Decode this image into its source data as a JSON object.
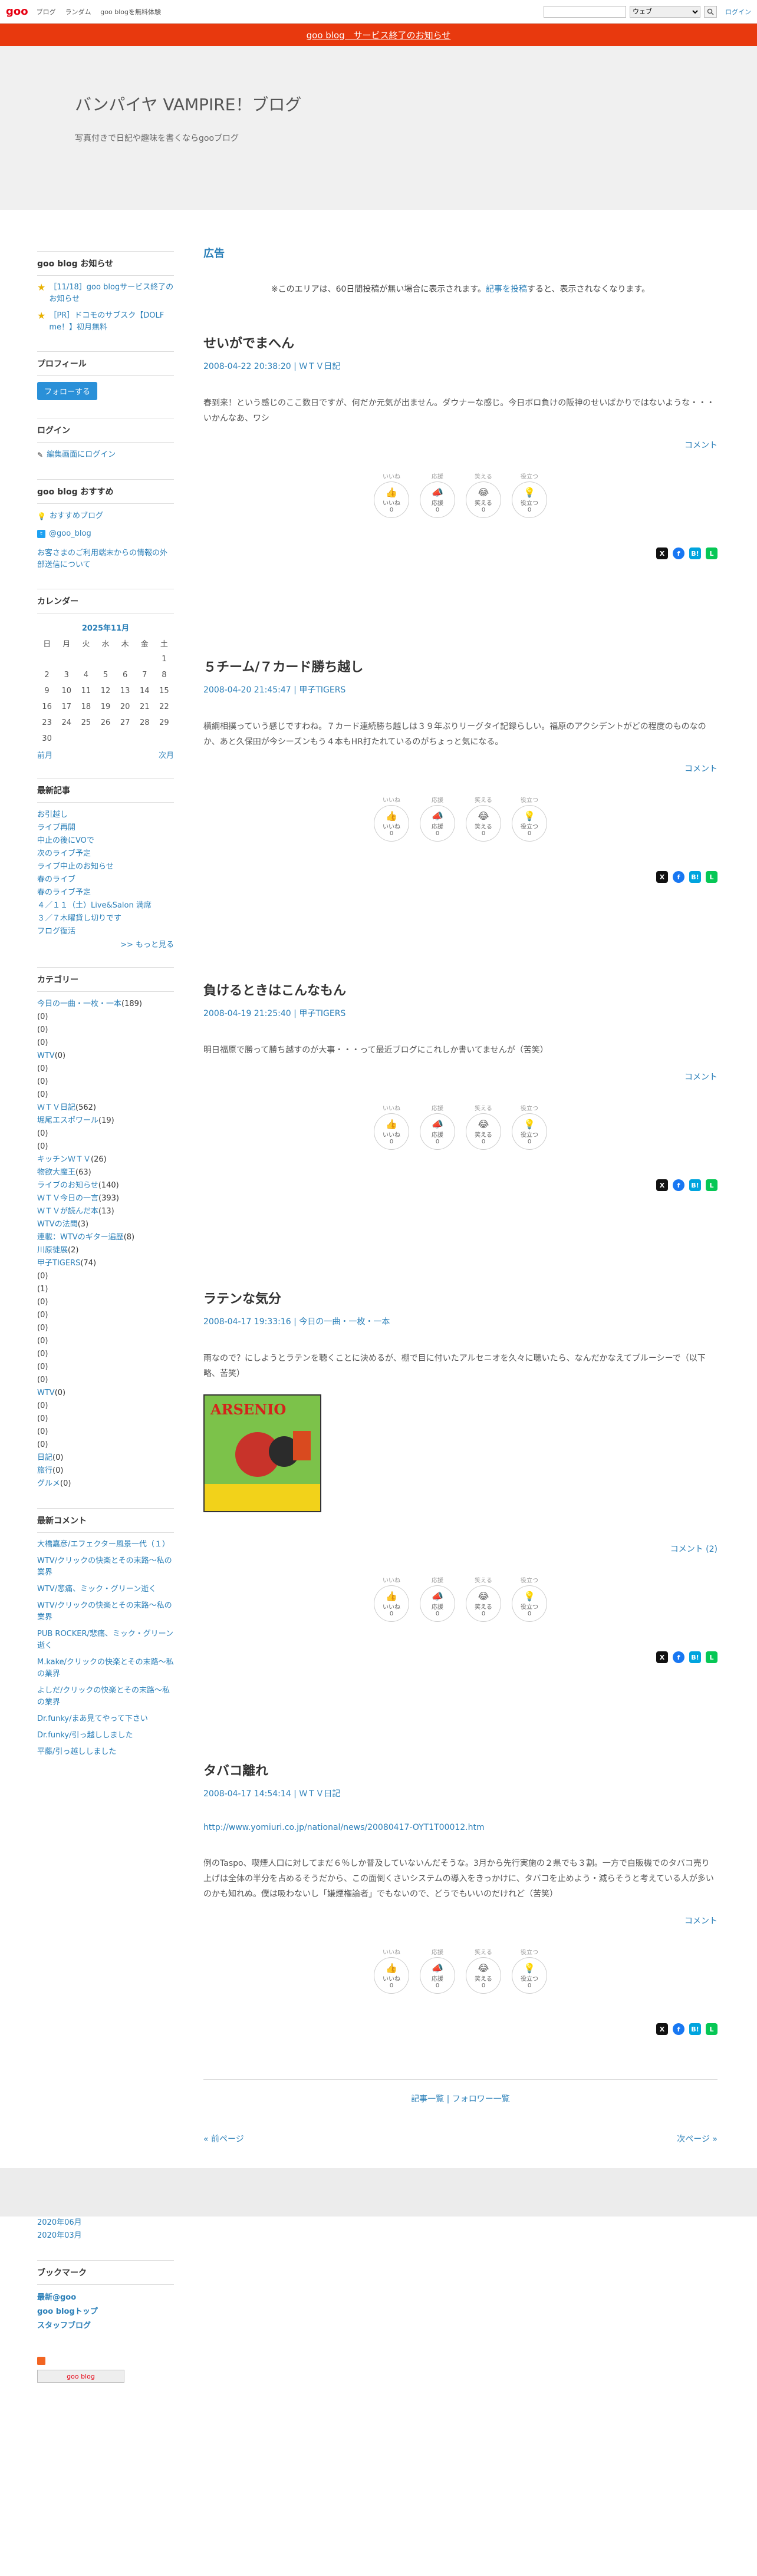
{
  "topbar": {
    "logo": "goo",
    "nav": [
      "ブログ",
      "ランダム",
      "goo blogを無料体験"
    ],
    "search_select": "ウェブ",
    "login": "ログイン"
  },
  "notice": "goo blog　サービス終了のお知らせ",
  "header": {
    "title": "バンパイヤ VAMPIRE！ブログ",
    "description": "写真付きで日記や趣味を書くならgooブログ"
  },
  "sidebar": {
    "info_heading": "goo blog お知らせ",
    "info_items": [
      "［11/18］goo blogサービス終了のお知らせ",
      "［PR］ドコモのサブスク【DOLF me！】初月無料"
    ],
    "profile_heading": "プロフィール",
    "follow_label": "フォローする",
    "login_heading": "ログイン",
    "login_link": "編集画面にログイン",
    "recommend_heading": "goo blog おすすめ",
    "recommend_links": [
      "おすすめブログ",
      "@goo_blog",
      "お客さまのご利用端末からの情報の外部送信について"
    ],
    "calendar_heading": "カレンダー",
    "calendar": {
      "caption": "2025年11月",
      "weekdays": [
        "日",
        "月",
        "火",
        "水",
        "木",
        "金",
        "土"
      ],
      "weeks": [
        [
          "",
          "",
          "",
          "",
          "",
          "",
          "1"
        ],
        [
          "2",
          "3",
          "4",
          "5",
          "6",
          "7",
          "8"
        ],
        [
          "9",
          "10",
          "11",
          "12",
          "13",
          "14",
          "15"
        ],
        [
          "16",
          "17",
          "18",
          "19",
          "20",
          "21",
          "22"
        ],
        [
          "23",
          "24",
          "25",
          "26",
          "27",
          "28",
          "29"
        ],
        [
          "30",
          "",
          "",
          "",
          "",
          "",
          ""
        ]
      ],
      "prev": "前月",
      "next": "次月"
    },
    "recent_heading": "最新記事",
    "recent_links": [
      "お引越し",
      "ライブ再開",
      "中止の後にVOで",
      "次のライブ予定",
      "ライブ中止のお知らせ",
      "春のライブ",
      "春のライブ予定",
      "４／１１（土）Live&Salon 満席",
      "３／７木曜貸し切りです",
      "フログ復活"
    ],
    "recent_more": ">> もっと見る",
    "category_heading": "カテゴリー",
    "categories": [
      {
        "name": "今日の一曲・一枚・一本",
        "count": "(189)"
      },
      {
        "name": "",
        "count": "(0)"
      },
      {
        "name": "",
        "count": "(0)"
      },
      {
        "name": "",
        "count": "(0)"
      },
      {
        "name": "WTV",
        "count": "(0)"
      },
      {
        "name": "",
        "count": "(0)"
      },
      {
        "name": "",
        "count": "(0)"
      },
      {
        "name": "",
        "count": "(0)"
      },
      {
        "name": "ＷＴＶ日記",
        "count": "(562)"
      },
      {
        "name": "堀尾エスポワール",
        "count": "(19)"
      },
      {
        "name": "",
        "count": "(0)"
      },
      {
        "name": "",
        "count": "(0)"
      },
      {
        "name": "キッチンＷＴＶ",
        "count": "(26)"
      },
      {
        "name": "物欲大魔王",
        "count": "(63)"
      },
      {
        "name": "ライブのお知らせ",
        "count": "(140)"
      },
      {
        "name": "ＷＴＶ今日の一言",
        "count": "(393)"
      },
      {
        "name": "ＷＴＶが読んだ本",
        "count": "(13)"
      },
      {
        "name": "WTVの法問",
        "count": "(3)"
      },
      {
        "name": "連載：WTVのギター遍歴",
        "count": "(8)"
      },
      {
        "name": "川原徒展",
        "count": "(2)"
      },
      {
        "name": "甲子TIGERS",
        "count": "(74)"
      },
      {
        "name": "",
        "count": "(0)"
      },
      {
        "name": "",
        "count": "(1)"
      },
      {
        "name": "",
        "count": "(0)"
      },
      {
        "name": "",
        "count": "(0)"
      },
      {
        "name": "",
        "count": "(0)"
      },
      {
        "name": "",
        "count": "(0)"
      },
      {
        "name": "",
        "count": "(0)"
      },
      {
        "name": "",
        "count": "(0)"
      },
      {
        "name": "",
        "count": "(0)"
      },
      {
        "name": "WTV",
        "count": "(0)"
      },
      {
        "name": "",
        "count": "(0)"
      },
      {
        "name": "",
        "count": "(0)"
      },
      {
        "name": "",
        "count": "(0)"
      },
      {
        "name": "",
        "count": "(0)"
      },
      {
        "name": "日記",
        "count": "(0)"
      },
      {
        "name": "旅行",
        "count": "(0)"
      },
      {
        "name": "グルメ",
        "count": "(0)"
      }
    ],
    "comments_heading": "最新コメント",
    "comments": [
      "大橋嘉彦/エフェクター風景一代（１）",
      "WTV/クリックの快楽とその末路～私の業界",
      "WTV/悲痛、ミック・グリーン逝く",
      "WTV/クリックの快楽とその末路～私の業界",
      "PUB ROCKER/悲痛、ミック・グリーン逝く",
      "M.kake/クリックの快楽とその末路～私の業界",
      "よしだ/クリックの快楽とその末路～私の業界",
      "Dr.funky/まあ見てやって下さい",
      "Dr.funky/引っ越ししました",
      "平藤/引っ越ししました"
    ]
  },
  "main": {
    "ad_title": "広告",
    "ad_note_before": "※このエリアは、60日間投稿が無い場合に表示されます。",
    "ad_note_link": "記事を投稿",
    "ad_note_after": "すると、表示されなくなります。",
    "comment_label": "コメント",
    "reactions": [
      {
        "top": "いいね",
        "emoji": "👍",
        "label": "いいね",
        "count": "0"
      },
      {
        "top": "応援",
        "emoji": "📣",
        "label": "応援",
        "count": "0"
      },
      {
        "top": "笑える",
        "emoji": "😂",
        "label": "笑える",
        "count": "0"
      },
      {
        "top": "役立つ",
        "emoji": "💡",
        "label": "役立つ",
        "count": "0"
      }
    ],
    "posts": [
      {
        "title": "せいがでまへん",
        "date": "2008-04-22 20:38:20",
        "category": "ＷＴＶ日記",
        "body": "春到来！という感じのここ数日ですが、何だか元気が出ません。ダウナーな感じ。今日ボロ負けの阪神のせいばかりではないような・・・いかんなあ、ワシ",
        "comment": "コメント"
      },
      {
        "title": "５チーム/７カード勝ち越し",
        "date": "2008-04-20 21:45:47",
        "category": "甲子TIGERS",
        "body": "横綱相撲っていう感じですわね。７カード連続勝ち越しは３９年ぶりリーグタイ記録らしい。福原のアクシデントがどの程度のものなのか、あと久保田が今シーズンもう４本もHR打たれているのがちょっと気になる。",
        "comment": "コメント"
      },
      {
        "title": "負けるときはこんなもん",
        "date": "2008-04-19 21:25:40",
        "category": "甲子TIGERS",
        "body": "明日福原で勝って勝ち越すのが大事・・・って最近ブログにこれしか書いてませんが（苦笑）",
        "comment": "コメント"
      },
      {
        "title": "ラテンな気分",
        "date": "2008-04-17 19:33:16",
        "category": "今日の一曲・一枚・一本",
        "body": "雨なので？にしようとラテンを聴くことに決めるが、棚で目に付いたアルセニオを久々に聴いたら、なんだかなえてブルーシーで（以下略、苦笑）",
        "comment": "コメント (2)",
        "image_text": "ARSENIO"
      },
      {
        "title": "タバコ離れ",
        "date": "2008-04-17 14:54:14",
        "category": "ＷＴＶ日記",
        "url": "http://www.yomiuri.co.jp/national/news/20080417-OYT1T00012.htm",
        "body": "例のTaspo、喫煙人口に対してまだ６％しか普及していないんだそうな。3月から先行実施の２県でも３割。一方で自販機でのタバコ売り上げは全体の半分を占めるそうだから、この面倒くさいシステムの導入をきっかけに、タバコを止めよう・減らそうと考えている人が多いのかも知れぬ。僕は吸わないし「嫌煙権論者」でもないので、どうでもいいのだけれど（苦笑）",
        "comment": "コメント"
      }
    ],
    "list_links": "記事一覧 | フォロワー一覧",
    "prev_page": "« 前ページ",
    "next_page": "次ページ »"
  },
  "bottom": {
    "archives": [
      "2020年06月",
      "2020年03月"
    ],
    "bookmark_heading": "ブックマーク",
    "bookmarks": [
      "最新@goo",
      "goo blogトップ",
      "スタッフブログ"
    ],
    "badge": "goo blog"
  }
}
